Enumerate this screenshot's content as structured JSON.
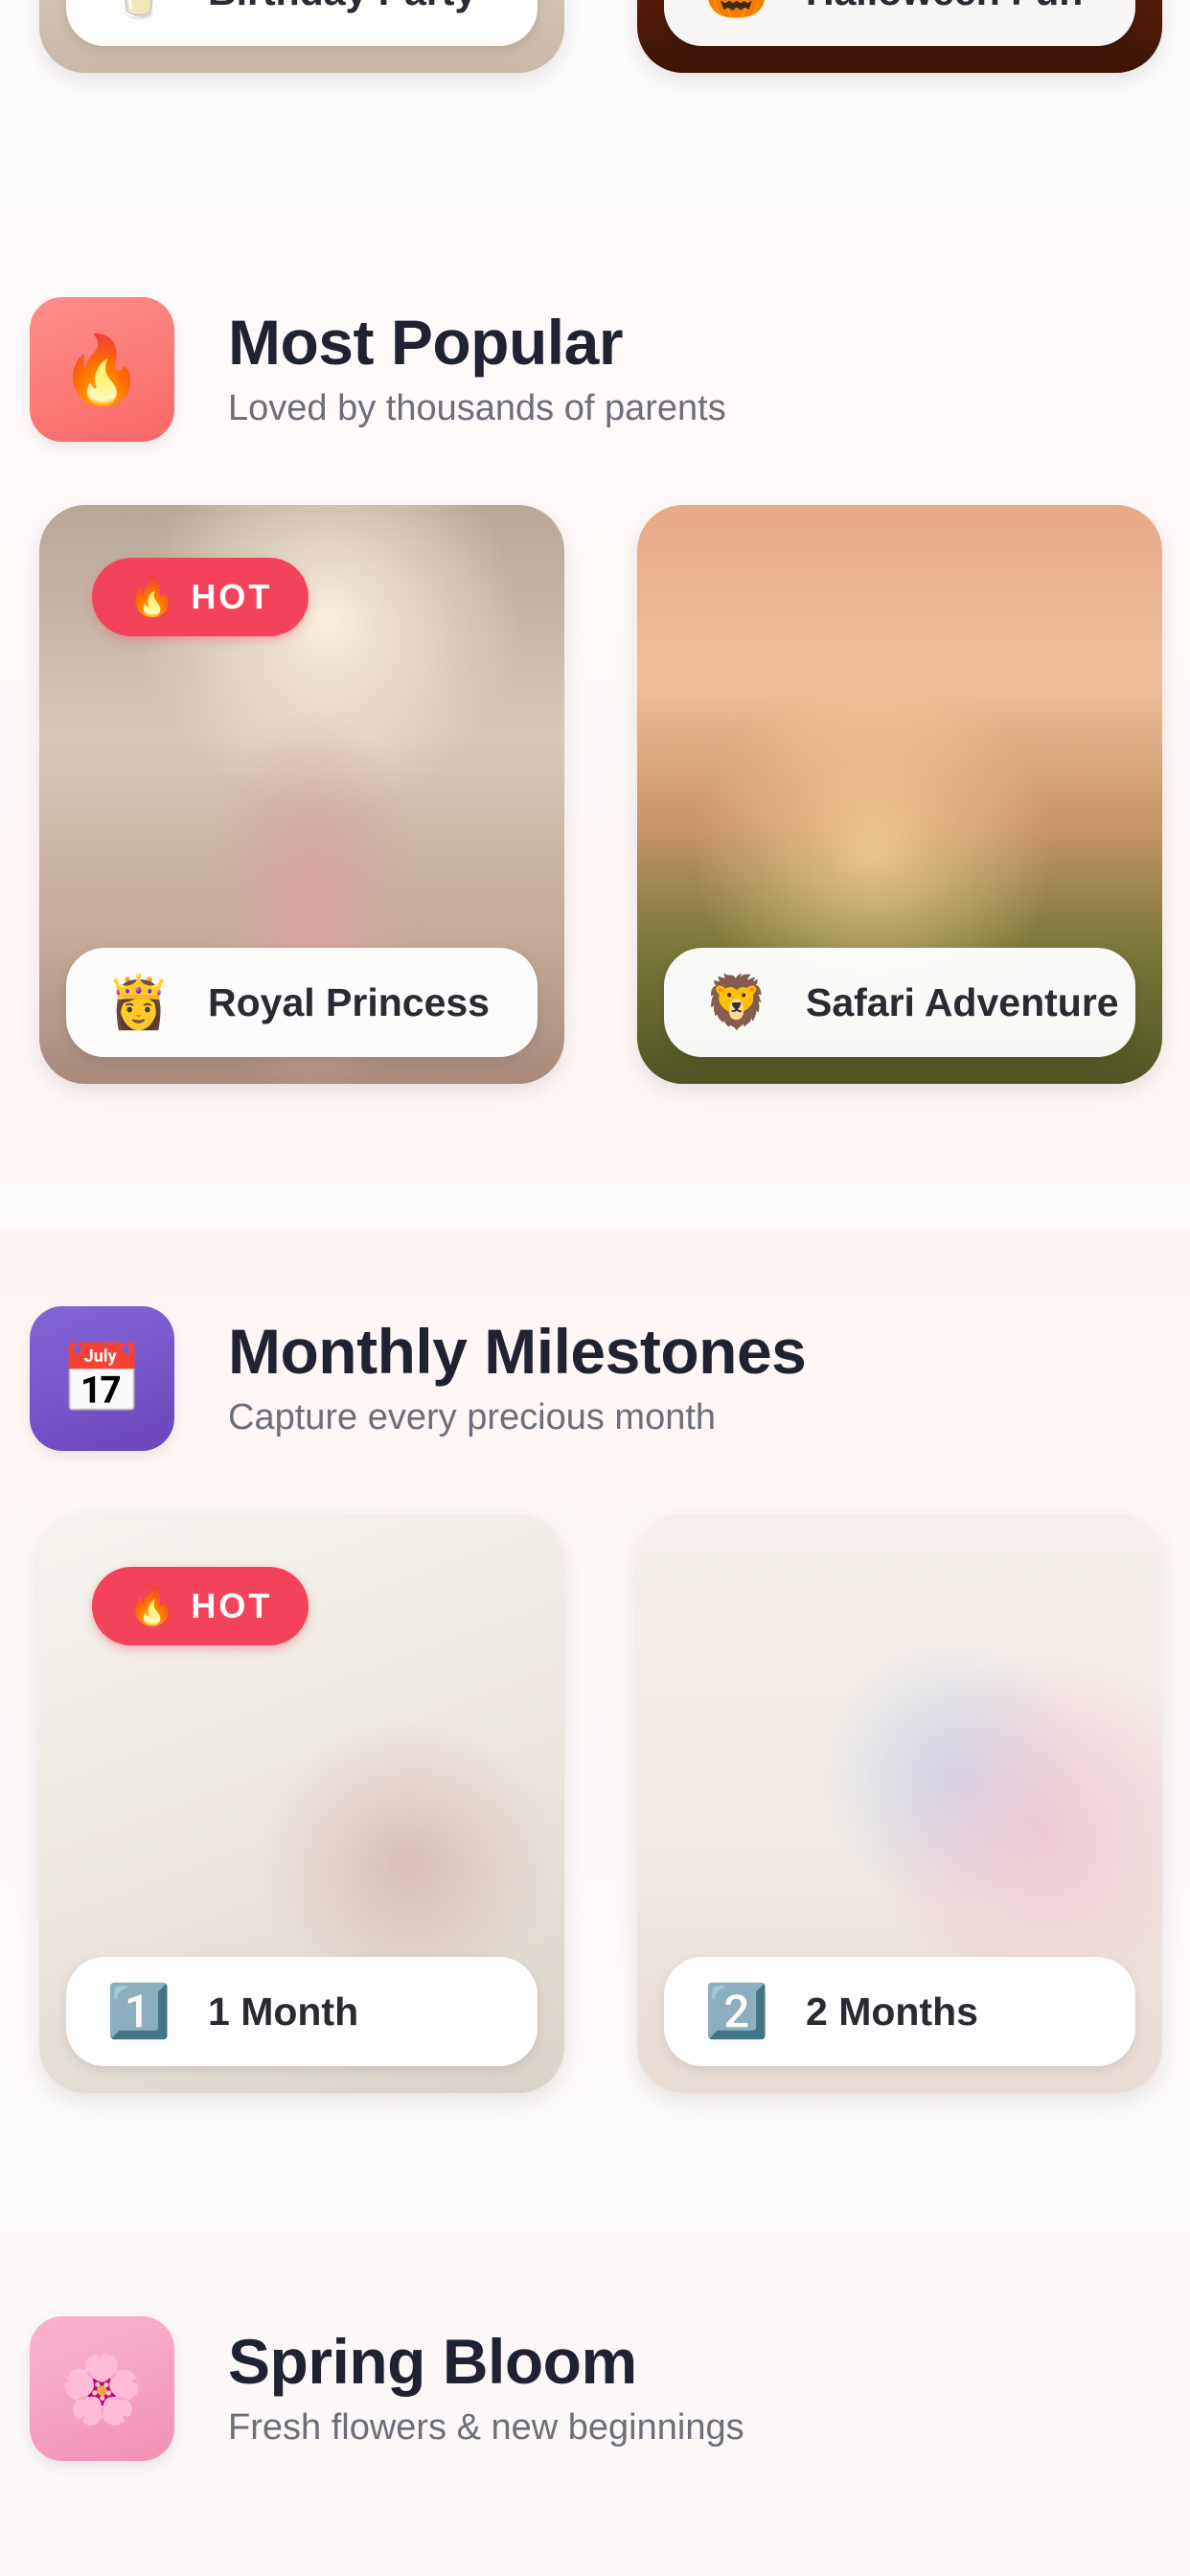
{
  "top_row": {
    "cards": [
      {
        "label": "Birthday Party",
        "emoji": "🥛"
      },
      {
        "label": "Halloween Fun",
        "emoji": "🎃"
      }
    ]
  },
  "sections": {
    "popular": {
      "icon_emoji": "🔥",
      "icon_color": "#fb7a78",
      "title": "Most Popular",
      "subtitle": "Loved by thousands of parents",
      "cards": [
        {
          "label": "Royal Princess",
          "emoji": "👸",
          "badge": "HOT",
          "badge_emoji": "🔥"
        },
        {
          "label": "Safari Adventure",
          "emoji": "🦁"
        }
      ]
    },
    "monthly": {
      "icon_emoji": "📅",
      "icon_color": "#7556c9",
      "title": "Monthly Milestones",
      "subtitle": "Capture every precious month",
      "cards": [
        {
          "label": "1 Month",
          "emoji": "1️⃣",
          "badge": "HOT",
          "badge_emoji": "🔥"
        },
        {
          "label": "2 Months",
          "emoji": "2️⃣"
        }
      ]
    },
    "spring": {
      "icon_emoji": "🌸",
      "icon_color": "#f6a3c2",
      "title": "Spring Bloom",
      "subtitle": "Fresh flowers & new beginnings"
    }
  },
  "colors": {
    "hot_badge": "#f2435a",
    "title_text": "#1f2230",
    "subtitle_text": "#6c6e7a"
  }
}
